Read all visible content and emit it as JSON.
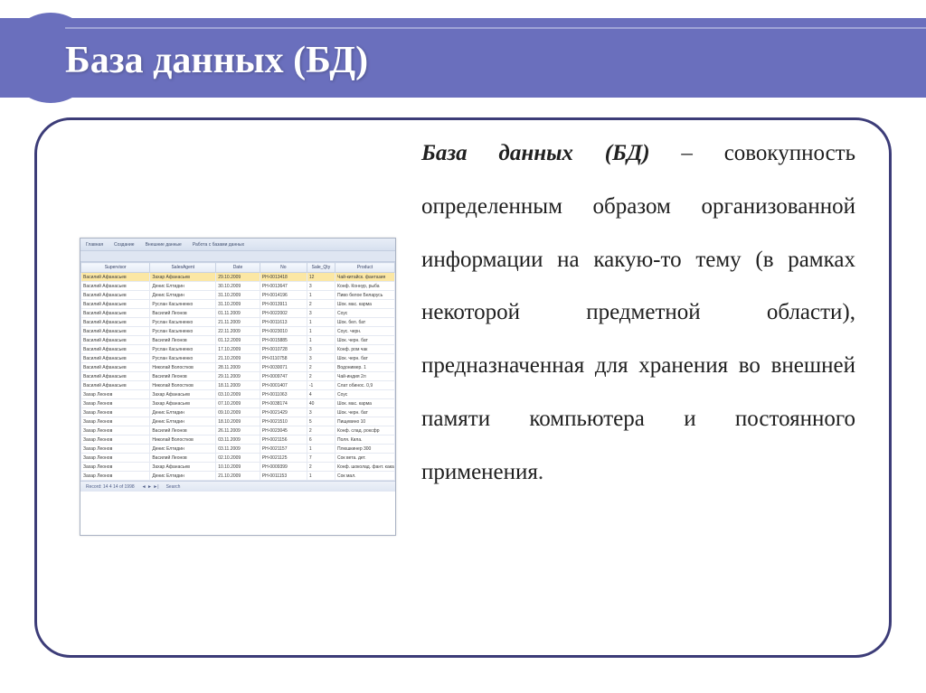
{
  "title": "База данных (БД)",
  "definition": {
    "term": "База данных (БД)",
    "dash": " – ",
    "part1": "совокупность определенным образом организованной информации на какую-то тему (в рамках некоторой предметной области), предназначенная для хранения во внешней памяти компьютера и постоянного применения",
    "trailing_dot": "."
  },
  "ribbon_tabs": [
    "Главная",
    "Создание",
    "Внешние данные",
    "Работа с базами данных"
  ],
  "db_header": [
    "Supervisor",
    "SalesAgent",
    "Date",
    "No",
    "Sale_Qty",
    "Product"
  ],
  "db_rows": [
    [
      "Василий Афанасьев",
      "Захар Афанасьев",
      "29.10.2009",
      "PH-0013418",
      "12",
      "Чай-китайск. фантазия"
    ],
    [
      "Василий Афанасьев",
      "Денис Елтидин",
      "30.10.2009",
      "PH-0013647",
      "3",
      "Конф. Коннур, рыба"
    ],
    [
      "Василий Афанасьев",
      "Денис Елтидин",
      "31.10.2009",
      "PH-0014196",
      "1",
      "Пиво белое Беларусь"
    ],
    [
      "Василий Афанасьев",
      "Руслан Касьяненко",
      "31.10.2009",
      "PH-0013911",
      "2",
      "Шок. мас. карма"
    ],
    [
      "Василий Афанасьев",
      "Василий Леонов",
      "01.11.2009",
      "PH-0022002",
      "3",
      "Соус"
    ],
    [
      "Василий Афанасьев",
      "Руслан Касьяненко",
      "21.11.2009",
      "PH-0011613",
      "1",
      "Шок. бел. бат"
    ],
    [
      "Василий Афанасьев",
      "Руслан Касьяненко",
      "22.11.2009",
      "PH-0023010",
      "1",
      "Соус. черн."
    ],
    [
      "Василий Афанасьев",
      "Василий Леонов",
      "01.12.2009",
      "PH-0015885",
      "1",
      "Шок. черн. бат"
    ],
    [
      "Василий Афанасьев",
      "Руслан Касьяненко",
      "17.10.2009",
      "PH-0010728",
      "3",
      "Конф. ром чак"
    ],
    [
      "Василий Афанасьев",
      "Руслан Касьяненко",
      "21.10.2009",
      "PH-0110758",
      "3",
      "Шок. черн. бат"
    ],
    [
      "Василий Афанасьев",
      "Николай Волостков",
      "28.11.2009",
      "PH-0030071",
      "2",
      "Водонимер. 1"
    ],
    [
      "Василий Афанасьев",
      "Василий Леонов",
      "29.11.2009",
      "PH-0009747",
      "2",
      "Чай-индия 2л"
    ],
    [
      "Василий Афанасьев",
      "Николай Волостков",
      "18.11.2009",
      "PH-0001407",
      "-1",
      "Слат обинос. 0,9"
    ],
    [
      "Захар Леонов",
      "Захар Афанасьев",
      "03.10.2009",
      "PH-0011063",
      "4",
      "Соус"
    ],
    [
      "Захар Леонов",
      "Захар Афанасьев",
      "07.10.2009",
      "PH-0038174",
      "40",
      "Шок. мас. карма"
    ],
    [
      "Захар Леонов",
      "Денис Елтидин",
      "09.10.2009",
      "PH-0021429",
      "3",
      "Шок. черн. бат"
    ],
    [
      "Захар Леонов",
      "Денис Елтидин",
      "18.10.2009",
      "PH-0021510",
      "5",
      "Пищевино 10"
    ],
    [
      "Захар Леонов",
      "Василий Леонов",
      "26.11.2009",
      "PH-0023045",
      "2",
      "Конф. слад. роксфр"
    ],
    [
      "Захар Леонов",
      "Николай Волостков",
      "03.11.2009",
      "PH-0021156",
      "6",
      "Поля. Кила."
    ],
    [
      "Захар Леонов",
      "Денис Елтидин",
      "03.11.2009",
      "PH-0021157",
      "1",
      "Плюшкинер 300"
    ],
    [
      "Захар Леонов",
      "Василий Леонов",
      "02.10.2009",
      "PH-0021125",
      "7",
      "Сок вета. дет."
    ],
    [
      "Захар Леонов",
      "Захар Афанасьев",
      "10.10.2009",
      "PH-0009399",
      "2",
      "Конф. шоколад. фант. какао"
    ],
    [
      "Захар Леонов",
      "Денис Елтидин",
      "21.10.2009",
      "PH-0011153",
      "1",
      "Сок мал."
    ]
  ],
  "db_status": {
    "counter": "Record: 14  4  14  of  1998",
    "search_label": "Search"
  }
}
